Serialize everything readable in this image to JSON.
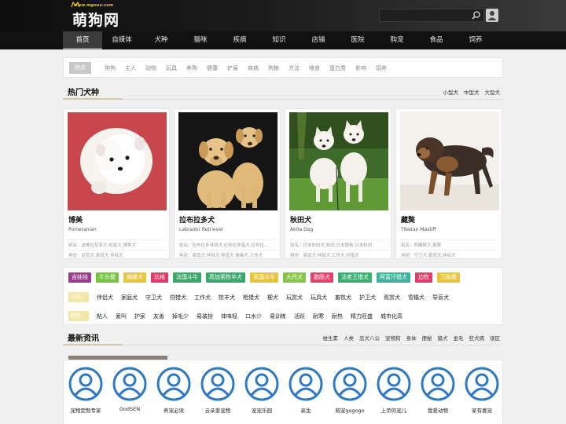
{
  "header": {
    "logo_domain": "www.mgous.com",
    "logo_text": "萌狗网",
    "search_placeholder": ""
  },
  "nav": [
    "首页",
    "自媒体",
    "犬种",
    "猫咪",
    "疾病",
    "知识",
    "店铺",
    "医院",
    "购宠",
    "食品",
    "饲养"
  ],
  "nav_active_index": 0,
  "keywords": {
    "first": "热点",
    "items": [
      "狗狗",
      "主人",
      "动物",
      "玩具",
      "养狗",
      "健康",
      "铲屎",
      "疾病",
      "狗粮",
      "方法",
      "嗜食",
      "蛋白质",
      "影响",
      "饲养"
    ]
  },
  "hot_breeds": {
    "title": "热门犬种",
    "filters": [
      "小型犬",
      "中型犬",
      "大型犬"
    ],
    "cards": [
      {
        "name": "博美",
        "en": "Pomeranian",
        "alias": "别名：波美拉尼亚犬,松鼠犬,博美犬",
        "use": "用途：玩赏犬,家庭犬,伴侣犬"
      },
      {
        "name": "拉布拉多犬",
        "en": "Labrador Retriever",
        "alias": "别名：拉布拉多寻回犬,拉布拉多猎犬,拉布拉...",
        "use": "用途：家庭犬,伴侣犬,导盲犬,搜毒犬,工作犬"
      },
      {
        "name": "秋田犬",
        "en": "Akita Dog",
        "alias": "别名：日本秋田犬,秋田,日本狼狗,日本秋田",
        "use": "用途：家庭犬,伴侣犬,工作犬,狩猎犬"
      },
      {
        "name": "藏獒",
        "en": "Tibetan Mastiff",
        "alias": "别名：西藏獒犬,蒙獒",
        "use": "用途：守卫犬,家庭犬,伴侣犬"
      }
    ]
  },
  "tags": {
    "colored": [
      {
        "label": "吉娃娃",
        "color": "#9b3b8c"
      },
      {
        "label": "牛头梗",
        "color": "#77c43f"
      },
      {
        "label": "蝴蝶犬",
        "color": "#e9c63b"
      },
      {
        "label": "比格",
        "color": "#e4396a"
      },
      {
        "label": "法国斗牛",
        "color": "#3ca76a"
      },
      {
        "label": "高加索牧羊犬",
        "color": "#3aa96d"
      },
      {
        "label": "英国斗牛",
        "color": "#e8c43a"
      },
      {
        "label": "大丹犬",
        "color": "#86c548"
      },
      {
        "label": "腊肠犬",
        "color": "#e7416a"
      },
      {
        "label": "法老王猎犬",
        "color": "#3bae72"
      },
      {
        "label": "阿富汗猎犬",
        "color": "#3fb29b"
      },
      {
        "label": "边牧",
        "color": "#e4396a"
      },
      {
        "label": "万能梗",
        "color": "#e8c43a"
      }
    ],
    "category_label": "分类：",
    "categories": [
      "伴侣犬",
      "家庭犬",
      "守卫犬",
      "狩猎犬",
      "工作犬",
      "牧羊犬",
      "枪猎犬",
      "梗犬",
      "玩赏犬",
      "玩具犬",
      "畜牧犬",
      "护卫犬",
      "观赏犬",
      "雪橇犬",
      "导盲犬"
    ],
    "trait_label": "特性：",
    "traits": [
      "粘人",
      "爱叫",
      "护家",
      "友善",
      "掉毛少",
      "易装扮",
      "体味轻",
      "口水少",
      "易训练",
      "活跃",
      "耐寒",
      "耐热",
      "精力旺盛",
      "城市化高"
    ]
  },
  "news": {
    "title": "最新资讯",
    "filters": [
      "维生素",
      "人类",
      "忠犬八公",
      "宠物狗",
      "身体",
      "便秘",
      "猎犬",
      "金毛",
      "狂犬病",
      "误区"
    ]
  },
  "authors": [
    "宠物定制专家",
    "GodSEN",
    "养宠必读",
    "云朵爱宠物",
    "宠宠乐园",
    "高生",
    "萌宠gogogo",
    "上帝的宠儿",
    "我爱动物",
    "家有喜宠"
  ],
  "colors": {
    "accent": "#d4c7a5",
    "avatar": "#2f78c4",
    "nav_bg": "#111111"
  }
}
